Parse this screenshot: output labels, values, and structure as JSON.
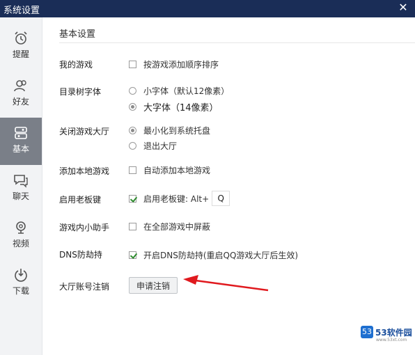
{
  "window": {
    "title": "系统设置"
  },
  "sidebar": {
    "items": [
      {
        "label": "提醒",
        "icon": "alarm-clock-icon",
        "active": false
      },
      {
        "label": "好友",
        "icon": "friends-icon",
        "active": false
      },
      {
        "label": "基本",
        "icon": "basic-settings-icon",
        "active": true
      },
      {
        "label": "聊天",
        "icon": "chat-icon",
        "active": false
      },
      {
        "label": "视频",
        "icon": "video-camera-icon",
        "active": false
      },
      {
        "label": "下载",
        "icon": "download-icon",
        "active": false
      }
    ]
  },
  "main": {
    "section_title": "基本设置",
    "rows": {
      "my_games": {
        "label": "我的游戏",
        "option": "按游戏添加顺序排序",
        "checked": false
      },
      "tree_font": {
        "label": "目录树字体",
        "small": "小字体（默认12像素）",
        "large": "大字体（14像素）",
        "selected": "large"
      },
      "close_hall": {
        "label": "关闭游戏大厅",
        "minimize": "最小化到系统托盘",
        "exit": "退出大厅",
        "selected": "minimize"
      },
      "add_local": {
        "label": "添加本地游戏",
        "option": "自动添加本地游戏",
        "checked": false
      },
      "boss_key": {
        "label": "启用老板键",
        "option": "启用老板键: Alt+",
        "key": "Q",
        "checked": true
      },
      "assistant": {
        "label": "游戏内小助手",
        "option": "在全部游戏中屏蔽",
        "checked": false
      },
      "dns": {
        "label": "DNS防劫持",
        "option": "开启DNS防劫持(重启QQ游戏大厅后生效)",
        "checked": true
      },
      "cancel_account": {
        "label": "大厅账号注销",
        "button": "申请注销"
      }
    }
  },
  "watermark": {
    "logo": "53",
    "text": "53软件园",
    "url": "www.53xt.com"
  },
  "colors": {
    "titlebar": "#1a2d57",
    "active_nav": "#7a7f88",
    "arrow": "#e0191e",
    "check": "#2e8b2e"
  }
}
